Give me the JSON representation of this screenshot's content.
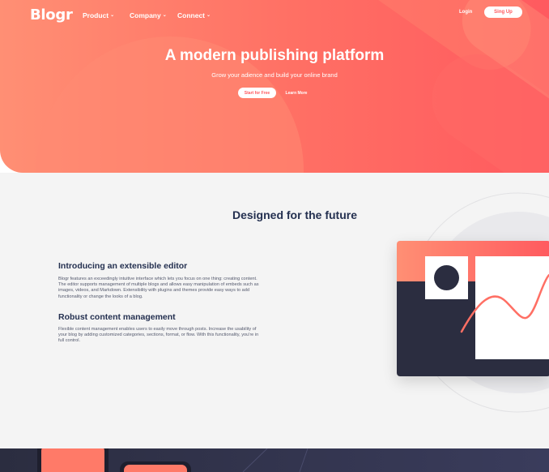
{
  "nav": {
    "logo": "Blogr",
    "items": [
      {
        "label": "Product"
      },
      {
        "label": "Company"
      },
      {
        "label": "Connect"
      }
    ],
    "chevron": "⌄",
    "login": "Login",
    "signup": "Sing Up"
  },
  "hero": {
    "title": "A modern publishing platform",
    "subtitle": "Grow your adience and build your online brand",
    "start_button": "Start for Free",
    "learn_button": "Learn More"
  },
  "features": {
    "section_title": "Designed for the future",
    "editor": {
      "title": "Introducing an extensible editor",
      "text": "Blogr features an exceedingly intuitive interface which lets you focus on one thing: creating content. The editor supports management of multiple blogs and allows easy manipulation of embeds such as images, videos, and Markdown. Extensibility with plugins and themes provide easy ways to add functionality or change the looks of a blog."
    },
    "content": {
      "title": "Robust content management",
      "text": "Flexible content management enables users to easily move through posts. Increase the usability of your blog by adding customized categories, sections, format, or flow. With this functionality, you're in full control."
    }
  },
  "colors": {
    "brand": "#ff5a5f",
    "navy": "#243050",
    "dark": "#2b2d40"
  }
}
